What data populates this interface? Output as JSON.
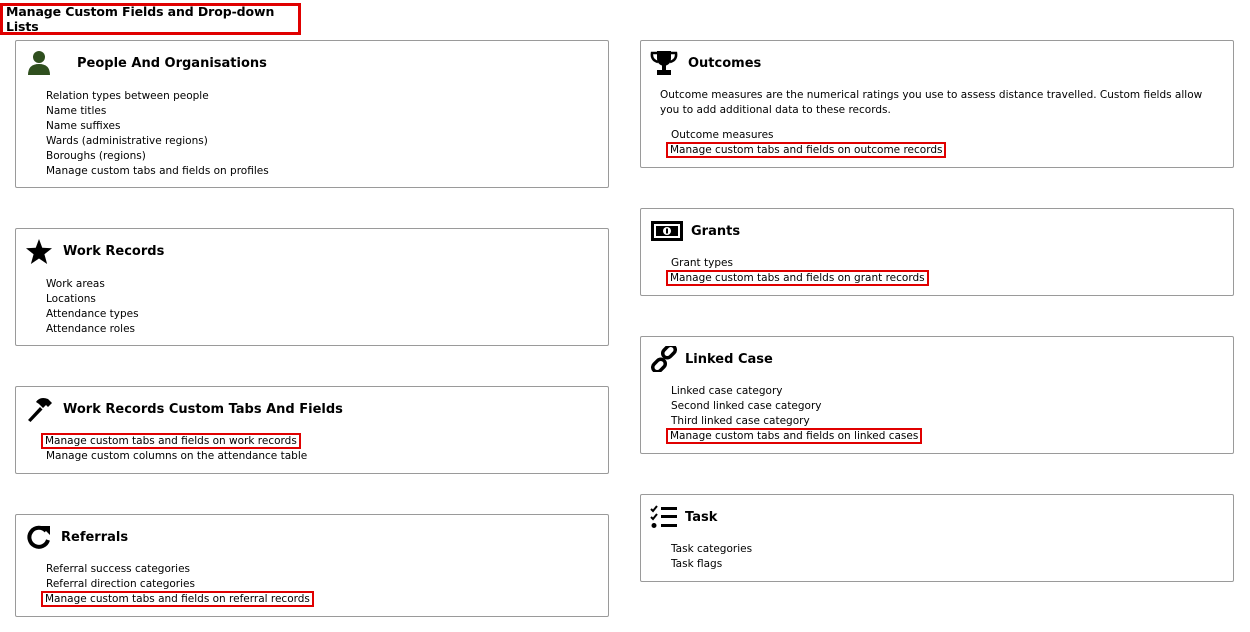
{
  "page": {
    "title": "Manage Custom Fields and Drop-down Lists"
  },
  "colors": {
    "highlight": "#e00000",
    "people_icon": "#2f4f1e",
    "border": "#9a9a9a"
  },
  "cards": {
    "people": {
      "title": "People And Organisations",
      "icon": "person-icon",
      "links": [
        "Relation types between people",
        "Name titles",
        "Name suffixes",
        "Wards (administrative regions)",
        "Boroughs (regions)",
        "Manage custom tabs and fields on profiles"
      ]
    },
    "work_records": {
      "title": "Work Records",
      "icon": "star-icon",
      "links": [
        "Work areas",
        "Locations",
        "Attendance types",
        "Attendance roles"
      ]
    },
    "work_custom": {
      "title": "Work Records Custom Tabs And Fields",
      "icon": "hammer-icon",
      "links": [
        "Manage custom tabs and fields on work records",
        "Manage custom columns on the attendance table"
      ]
    },
    "referrals": {
      "title": "Referrals",
      "icon": "redo-icon",
      "links": [
        "Referral success categories",
        "Referral direction categories",
        "Manage custom tabs and fields on referral records"
      ]
    },
    "outcomes": {
      "title": "Outcomes",
      "icon": "trophy-icon",
      "description": "Outcome measures are the numerical ratings you use to assess distance travelled. Custom fields allow you to add additional data to these records.",
      "links": [
        "Outcome measures",
        "Manage custom tabs and fields on outcome records"
      ]
    },
    "grants": {
      "title": "Grants",
      "icon": "money-bill-icon",
      "links": [
        "Grant types",
        "Manage custom tabs and fields on grant records"
      ]
    },
    "linked_case": {
      "title": "Linked Case",
      "icon": "link-icon",
      "links": [
        "Linked case category",
        "Second linked case category",
        "Third linked case category",
        "Manage custom tabs and fields on linked cases"
      ]
    },
    "task": {
      "title": "Task",
      "icon": "task-list-icon",
      "links": [
        "Task categories",
        "Task flags"
      ]
    }
  }
}
